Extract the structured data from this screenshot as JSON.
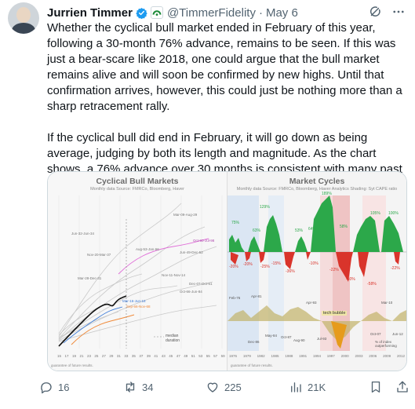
{
  "author": {
    "name": "Jurrien Timmer",
    "handle": "@TimmerFidelity",
    "separator": "·",
    "date": "May 6"
  },
  "tweet": {
    "paragraphs": [
      "Whether the cyclical bull market ended in February of this year, following a 30-month 76% advance, remains to be seen. If this was just a bear-scare like 2018, one could argue that the bull market remains alive and will soon be confirmed by new highs. Until that confirmation arrives, however, this could just be nothing more than a sharp retracement rally.",
      "If the cyclical bull did end in February, it will go down as being average, judging by both its length and magnitude. As the chart shows, a 76% advance over 30 months is consistent with many past bull markets. The concentration within the market has been anything but average of course."
    ]
  },
  "media": {
    "left_chart": {
      "title": "Cyclical Bull Markets",
      "subtitle": "Monthly data   Source: FMRCo, Bloomberg, Haver",
      "note": "guarantee of future results.",
      "annotations": [
        "Mar-09-Aug-29",
        "Jun-32-Jun-34",
        "Nov-20-Mar-37",
        "Aug-53-Jan-66",
        "Jun-49-Dec-52",
        "Oct-90-Jul-98",
        "Nov-11-Nov-14",
        "Mar-28-Dec-31",
        "Mar-16-Jun-18",
        "Dec-07-Oct-61",
        "Oct-66-Jun-84",
        "Sep-66-Nov-68"
      ],
      "legend": "median duration",
      "x_ticks": [
        "15",
        "17",
        "19",
        "21",
        "23",
        "25",
        "27",
        "29",
        "31",
        "33",
        "35",
        "37",
        "39",
        "41",
        "43",
        "45",
        "47",
        "49",
        "51",
        "53",
        "55",
        "57",
        "59"
      ]
    },
    "right_chart": {
      "title": "Market Cycles",
      "subtitle": "Monthly data   Source: FMRCo, Bloomberg, Haver Analytics   Shading: Syt CAPE ratio",
      "note": "guarantee of future results.",
      "labels_up": [
        "129%",
        "63%",
        "63%",
        "53%",
        "64%",
        "58%",
        "189%",
        "105%",
        "100%",
        "75%"
      ],
      "labels_down": [
        "-20%",
        "-25%",
        "-15%",
        "-36%",
        "-20%",
        "-10%",
        "-22%",
        "-50%",
        "-58%",
        "-22%"
      ],
      "dates": [
        "Feb-76",
        "Apr-81",
        "Apr-93",
        "May-84",
        "Oct-87",
        "Aug-90",
        "Jul-93",
        "Mar-10",
        "Oct-07",
        "Jun-12",
        "Dec-86"
      ],
      "callouts": [
        "tech bubble",
        "% of index outperforming"
      ],
      "x_ticks": [
        "1976",
        "1979",
        "1982",
        "1985",
        "1988",
        "1991",
        "1994",
        "1997",
        "2000",
        "2003",
        "2006",
        "2009",
        "2012"
      ]
    }
  },
  "actions": {
    "replies": "16",
    "retweets": "34",
    "likes": "225",
    "views": "21K"
  },
  "colors": {
    "verified": "#1d9bf0",
    "org_badge": "#1d8a3a",
    "up_bar": "#2ca84a",
    "down_bar": "#d9342b"
  }
}
